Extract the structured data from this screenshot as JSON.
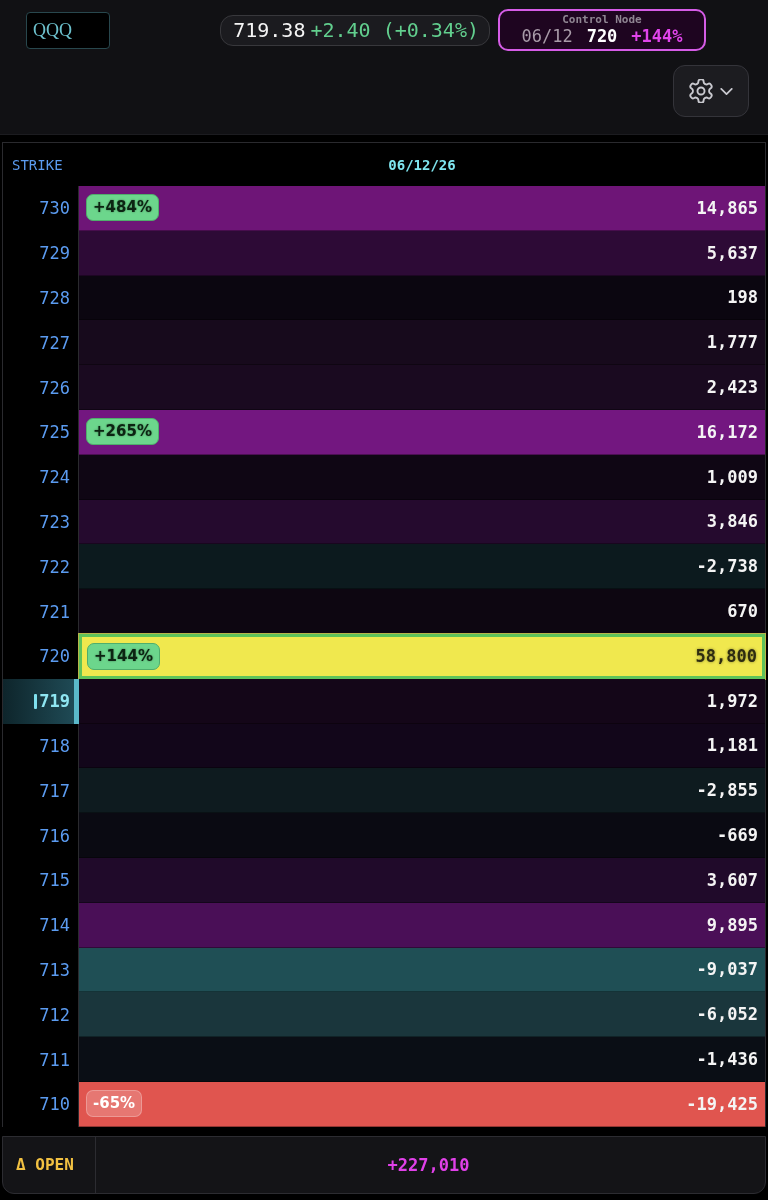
{
  "ticker": {
    "value": "QQQ"
  },
  "quote": {
    "price": "719.38",
    "change": "+2.40 (+0.34%)"
  },
  "control_node": {
    "label": "Control Node",
    "date": "06/12",
    "strike": "720",
    "change": "+144%"
  },
  "table": {
    "columns": [
      "STRIKE",
      "06/12/26"
    ],
    "rows": [
      {
        "strike": "730",
        "value": "14,865",
        "color": "#6e1577",
        "badge": {
          "text": "+484%",
          "kind": "gain"
        },
        "highlighted": false,
        "current": false
      },
      {
        "strike": "729",
        "value": "5,637",
        "color": "#2d0a36",
        "highlighted": false,
        "current": false
      },
      {
        "strike": "728",
        "value": "198",
        "color": "#0b0610",
        "highlighted": false,
        "current": false
      },
      {
        "strike": "727",
        "value": "1,777",
        "color": "#170a1c",
        "highlighted": false,
        "current": false
      },
      {
        "strike": "726",
        "value": "2,423",
        "color": "#1a0a20",
        "highlighted": false,
        "current": false
      },
      {
        "strike": "725",
        "value": "16,172",
        "color": "#731780",
        "badge": {
          "text": "+265%",
          "kind": "gain"
        },
        "highlighted": false,
        "current": false
      },
      {
        "strike": "724",
        "value": "1,009",
        "color": "#0f0614",
        "highlighted": false,
        "current": false
      },
      {
        "strike": "723",
        "value": "3,846",
        "color": "#250a2e",
        "highlighted": false,
        "current": false
      },
      {
        "strike": "722",
        "value": "-2,738",
        "color": "#0c1a1e",
        "highlighted": false,
        "current": false
      },
      {
        "strike": "721",
        "value": "670",
        "color": "#0d0611",
        "highlighted": false,
        "current": false
      },
      {
        "strike": "720",
        "value": "58,800",
        "color": "#f0e84e",
        "badge": {
          "text": "+144%",
          "kind": "gain"
        },
        "highlighted": true,
        "current": false
      },
      {
        "strike": "719",
        "value": "1,972",
        "color": "#140618",
        "highlighted": false,
        "current": true
      },
      {
        "strike": "718",
        "value": "1,181",
        "color": "#12061a",
        "highlighted": false,
        "current": false
      },
      {
        "strike": "717",
        "value": "-2,855",
        "color": "#0e1b1f",
        "highlighted": false,
        "current": false
      },
      {
        "strike": "716",
        "value": "-669",
        "color": "#0a0a12",
        "highlighted": false,
        "current": false
      },
      {
        "strike": "715",
        "value": "3,607",
        "color": "#200a2a",
        "highlighted": false,
        "current": false
      },
      {
        "strike": "714",
        "value": "9,895",
        "color": "#4a0f57",
        "highlighted": false,
        "current": false
      },
      {
        "strike": "713",
        "value": "-9,037",
        "color": "#1f4f55",
        "highlighted": false,
        "current": false
      },
      {
        "strike": "712",
        "value": "-6,052",
        "color": "#1a363c",
        "highlighted": false,
        "current": false
      },
      {
        "strike": "711",
        "value": "-1,436",
        "color": "#0a0e15",
        "highlighted": false,
        "current": false
      },
      {
        "strike": "710",
        "value": "-19,425",
        "color": "#e0554f",
        "badge": {
          "text": "-65%",
          "kind": "loss"
        },
        "highlighted": false,
        "current": false
      }
    ]
  },
  "footer": {
    "label": "Δ OPEN",
    "value": "+227,010"
  }
}
